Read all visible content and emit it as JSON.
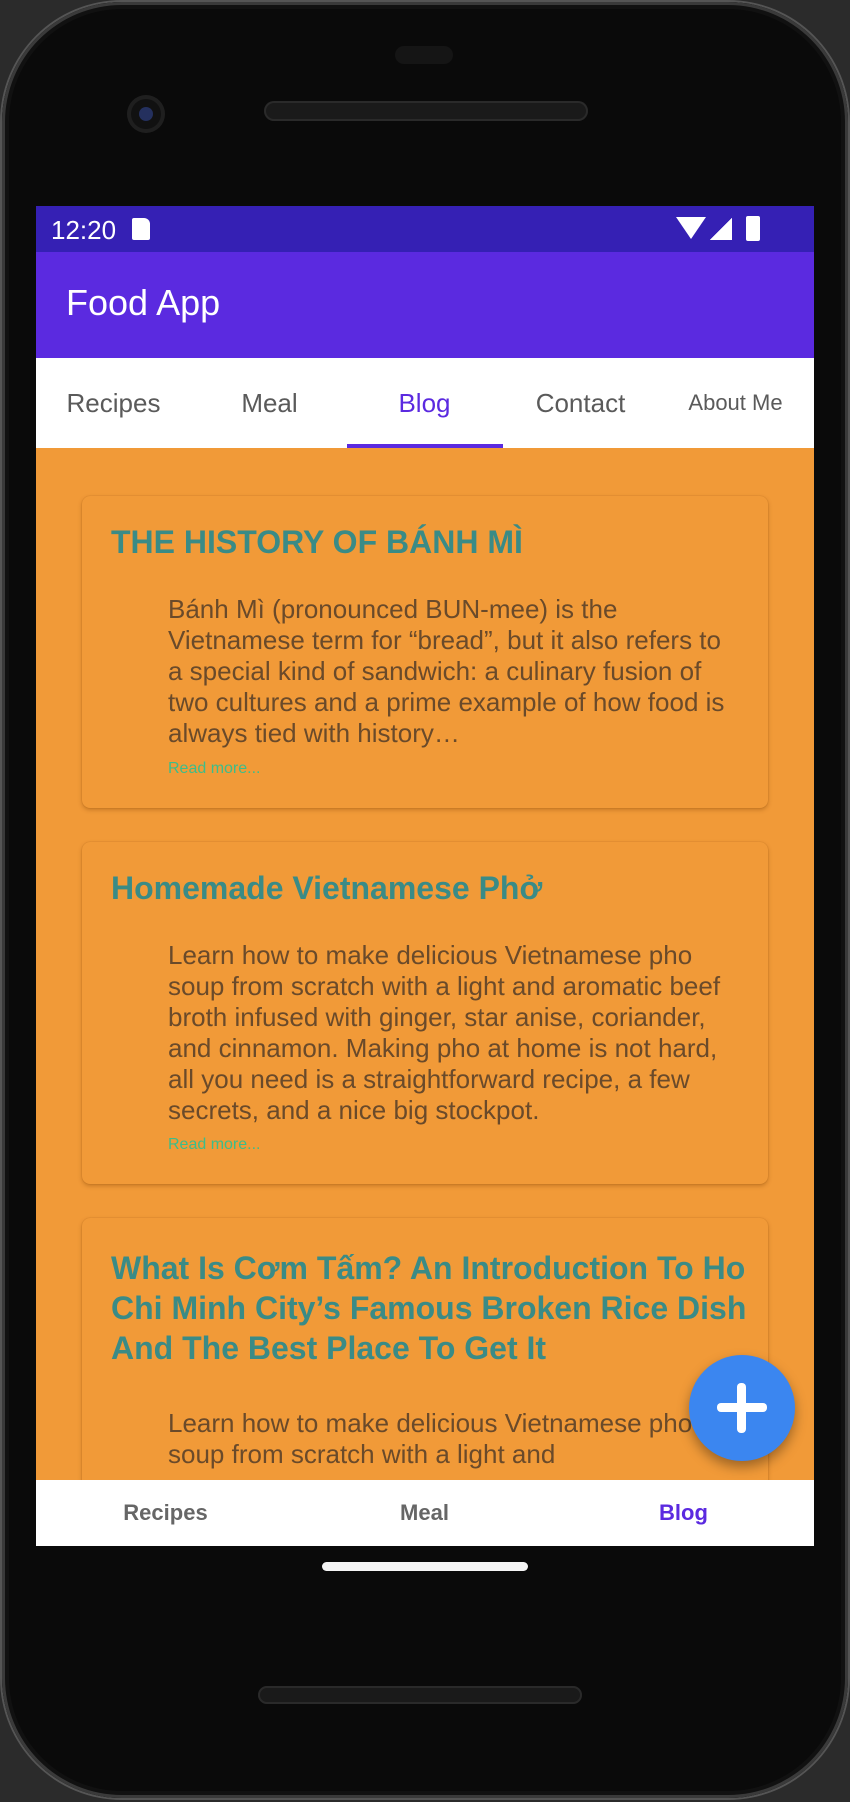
{
  "status_bar": {
    "time": "12:20"
  },
  "app_bar": {
    "title": "Food App"
  },
  "tabs": [
    {
      "label": "Recipes"
    },
    {
      "label": "Meal"
    },
    {
      "label": "Blog"
    },
    {
      "label": "Contact"
    },
    {
      "label": "About Me"
    }
  ],
  "active_tab": "Blog",
  "posts": [
    {
      "title": "THE HISTORY OF BÁNH MÌ",
      "body": "Bánh Mì (pronounced BUN-mee) is the Vietnamese term for “bread”, but it also refers to a special kind of sandwich: a culinary fusion of two cultures and a prime example of how food is always tied with history…",
      "read_more": "Read more..."
    },
    {
      "title": "Homemade Vietnamese Phở",
      "body": "Learn how to make delicious Vietnamese pho soup from scratch with a light and aromatic beef broth infused with ginger, star anise, coriander, and cinnamon. Making pho at home is not hard, all you need is a straightforward recipe, a few secrets, and a nice big stockpot.",
      "read_more": "Read more..."
    },
    {
      "title": "What Is Cơm Tấm? An Introduction To Ho Chi Minh City’s Famous Broken Rice Dish And The Best Place To Get It",
      "body": "Learn how to make delicious Vietnamese pho soup from scratch with a light and"
    }
  ],
  "bottom_nav": [
    {
      "label": "Recipes"
    },
    {
      "label": "Meal"
    },
    {
      "label": "Blog"
    }
  ],
  "active_bottom_nav": "Blog",
  "colors": {
    "status_bar": "#3520b4",
    "primary": "#5b2ae0",
    "content_bg": "#f19a38",
    "title_text": "#3a8b86",
    "read_more": "#3dbd8a",
    "fab": "#3b86f0"
  },
  "icons": [
    "sd-card-icon",
    "wifi-icon",
    "signal-icon",
    "battery-icon",
    "plus-icon"
  ]
}
